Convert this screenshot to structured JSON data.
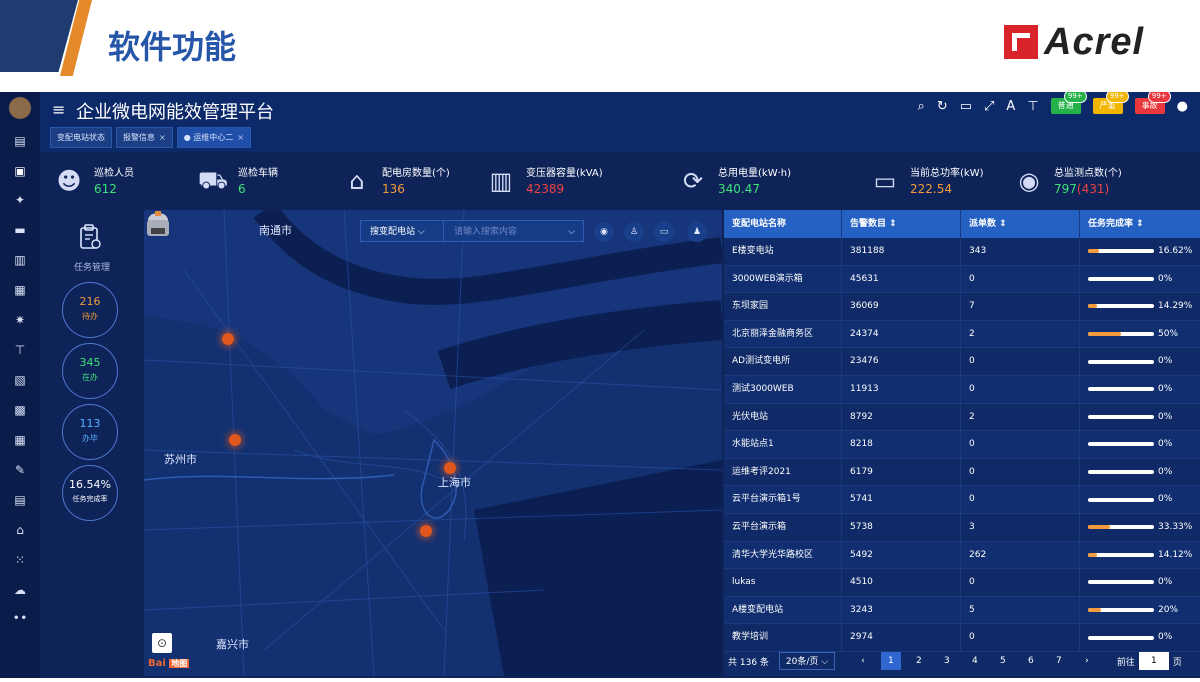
{
  "slide": {
    "title": "软件功能",
    "logo_text": "Acrel"
  },
  "app": {
    "title": "企业微电网能效管理平台",
    "tabs": [
      {
        "label": "变配电站状态"
      },
      {
        "label": "报警信息",
        "close": "×"
      },
      {
        "label": "● 运维中心二",
        "close": "×"
      }
    ],
    "header_pills": [
      {
        "label": "普通",
        "badge": "99+"
      },
      {
        "label": "严重",
        "badge": "99+"
      },
      {
        "label": "事故",
        "badge": "99+"
      }
    ]
  },
  "stats": [
    {
      "label": "巡检人员",
      "value": "612"
    },
    {
      "label": "巡检车辆",
      "value": "6"
    },
    {
      "label": "配电房数量(个)",
      "value": "136"
    },
    {
      "label": "变压器容量(kVA)",
      "value": "42389"
    },
    {
      "label": "总用电量(kW·h)",
      "value": "340.47"
    },
    {
      "label": "当前总功率(kW)",
      "value": "222.54"
    },
    {
      "label": "总监测点数(个)",
      "value": "797",
      "value_extra": "(431)"
    }
  ],
  "tasks": {
    "label": "任务管理",
    "items": [
      {
        "num": "216",
        "text": "待办"
      },
      {
        "num": "345",
        "text": "在办"
      },
      {
        "num": "113",
        "text": "办毕"
      },
      {
        "num": "16.54%",
        "text": "任务完成率"
      }
    ]
  },
  "map": {
    "cities": [
      "南通市",
      "苏州市",
      "上海市",
      "嘉兴市"
    ],
    "search_select": "搜变配电站",
    "search_placeholder": "请输入搜索内容",
    "baidu": "Bai",
    "baidu_tag": "地图"
  },
  "table": {
    "headers": [
      "变配电站名称",
      "告警数目 ⇕",
      "派单数 ⇕",
      "任务完成率 ⇕"
    ],
    "rows": [
      {
        "name": "E楼变电站",
        "alarms": "381188",
        "orders": "343",
        "rate": "16.62%",
        "frac": 0.1662
      },
      {
        "name": "3000WEB演示箱",
        "alarms": "45631",
        "orders": "0",
        "rate": "0%",
        "frac": 0
      },
      {
        "name": "东坝家园",
        "alarms": "36069",
        "orders": "7",
        "rate": "14.29%",
        "frac": 0.1429
      },
      {
        "name": "北京丽泽金融商务区",
        "alarms": "24374",
        "orders": "2",
        "rate": "50%",
        "frac": 0.5
      },
      {
        "name": "AD测试变电所",
        "alarms": "23476",
        "orders": "0",
        "rate": "0%",
        "frac": 0
      },
      {
        "name": "测试3000WEB",
        "alarms": "11913",
        "orders": "0",
        "rate": "0%",
        "frac": 0
      },
      {
        "name": "光伏电站",
        "alarms": "8792",
        "orders": "2",
        "rate": "0%",
        "frac": 0
      },
      {
        "name": "水能站点1",
        "alarms": "8218",
        "orders": "0",
        "rate": "0%",
        "frac": 0
      },
      {
        "name": "运维考评2021",
        "alarms": "6179",
        "orders": "0",
        "rate": "0%",
        "frac": 0
      },
      {
        "name": "云平台演示箱1号",
        "alarms": "5741",
        "orders": "0",
        "rate": "0%",
        "frac": 0
      },
      {
        "name": "云平台演示箱",
        "alarms": "5738",
        "orders": "3",
        "rate": "33.33%",
        "frac": 0.3333
      },
      {
        "name": "清华大学光华路校区",
        "alarms": "5492",
        "orders": "262",
        "rate": "14.12%",
        "frac": 0.1412
      },
      {
        "name": "lukas",
        "alarms": "4510",
        "orders": "0",
        "rate": "0%",
        "frac": 0
      },
      {
        "name": "A楼变配电站",
        "alarms": "3243",
        "orders": "5",
        "rate": "20%",
        "frac": 0.2
      },
      {
        "name": "教学培训",
        "alarms": "2974",
        "orders": "0",
        "rate": "0%",
        "frac": 0
      }
    ],
    "pager": {
      "total": "共 136 条",
      "page_size": "20条/页",
      "pages": [
        "1",
        "2",
        "3",
        "4",
        "5",
        "6",
        "7"
      ],
      "prev": "‹",
      "next": "›",
      "goto_label": "前往",
      "goto_value": "1",
      "goto_suffix": "页"
    }
  },
  "colors": {
    "accent": "#2561c2",
    "green": "#3ee07a",
    "orange": "#f39a3c",
    "red": "#ee4444"
  }
}
